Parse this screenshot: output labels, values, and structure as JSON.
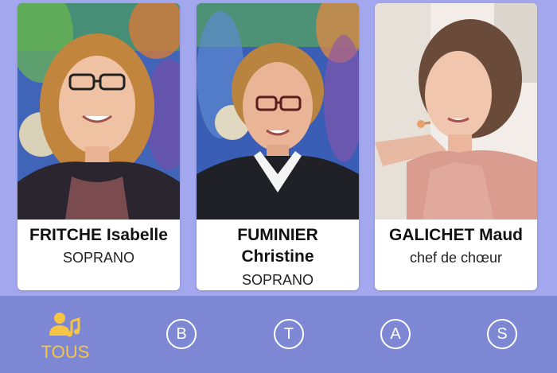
{
  "cards": [
    {
      "name": "FRITCHE Isabelle",
      "role": "SOPRANO",
      "photo": "portrait-woman-glasses"
    },
    {
      "name_line1": "FUMINIER",
      "name_line2": "Christine",
      "role": "SOPRANO",
      "photo": "portrait-woman-glasses-white-collar"
    },
    {
      "name": "GALICHET Maud",
      "role": "chef de chœur",
      "photo": "portrait-conductor-headset"
    }
  ],
  "tabs": [
    {
      "label": "TOUS",
      "icon": "choir-group-music-icon",
      "active": true
    },
    {
      "label": "B"
    },
    {
      "label": "T"
    },
    {
      "label": "A"
    },
    {
      "label": "S"
    }
  ],
  "colors": {
    "background": "#a3a8ee",
    "bottom_bar": "#7d87d4",
    "active_tab": "#f6c544"
  }
}
